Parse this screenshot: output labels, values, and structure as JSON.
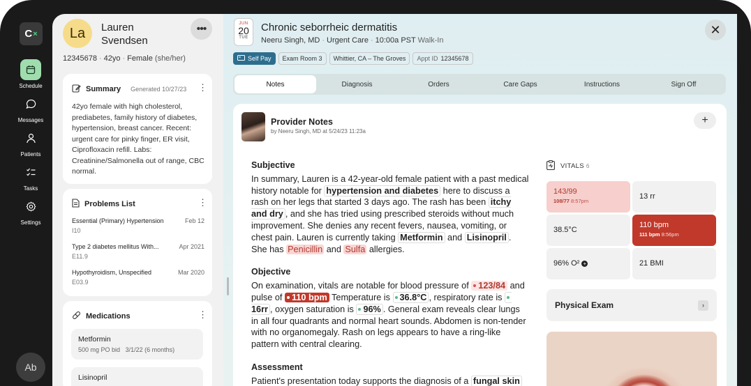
{
  "app": {
    "logo_text": "C",
    "logo_mark": "×"
  },
  "nav": [
    {
      "label": "Schedule",
      "icon": "calendar-icon",
      "active": true
    },
    {
      "label": "Messages",
      "icon": "message-icon",
      "active": false
    },
    {
      "label": "Patients",
      "icon": "person-icon",
      "active": false
    },
    {
      "label": "Tasks",
      "icon": "tasks-icon",
      "active": false
    },
    {
      "label": "Settings",
      "icon": "gear-icon",
      "active": false
    }
  ],
  "user": {
    "initials": "Ab"
  },
  "patient": {
    "initials": "La",
    "first_name": "Lauren",
    "last_name": "Svendsen",
    "mrn": "12345678",
    "age": "42yo",
    "sex": "Female",
    "pronouns": "(she/her)"
  },
  "summary": {
    "title": "Summary",
    "generated": "Generated 10/27/23",
    "text": "42yo female with high cholesterol, prediabetes, family history of diabetes, hypertension, breast cancer. Recent: urgent care for pinky finger, ER visit, Ciprofloxacin refill. Labs: Creatinine/Salmonella out of range, CBC normal."
  },
  "problems": {
    "title": "Problems List",
    "items": [
      {
        "name": "Essential (Primary) Hypertension",
        "code": "I10",
        "date": "Feb 12"
      },
      {
        "name": "Type 2 diabetes mellitus With...",
        "code": "E11.9",
        "date": "Apr 2021"
      },
      {
        "name": "Hypothyroidism, Unspecified",
        "code": "E03.9",
        "date": "Mar 2020"
      }
    ]
  },
  "medications": {
    "title": "Medications",
    "items": [
      {
        "name": "Metformin",
        "sig": "500 mg PO bid",
        "date": "3/1/22 (6 months)"
      },
      {
        "name": "Lisinopril",
        "sig": "",
        "date": ""
      }
    ]
  },
  "encounter": {
    "month": "JUN",
    "day": "20",
    "weekday": "TUE",
    "title": "Chronic seborrheic dermatitis",
    "provider": "Neeru Singh, MD",
    "type": "Urgent Care",
    "time": "10:00a PST",
    "visit": "Walk-In",
    "tags": {
      "pay": "Self Pay",
      "room": "Exam Room 3",
      "location": "Whittier, CA – The Groves",
      "appt_label": "Appt ID",
      "appt_id": "12345678"
    }
  },
  "tabs": [
    "Notes",
    "Diagnosis",
    "Orders",
    "Care Gaps",
    "Instructions",
    "Sign Off"
  ],
  "notes": {
    "title": "Provider Notes",
    "by": "by Neeru Singh, MD at 5/24/23 11:23a",
    "subjective": {
      "heading": "Subjective",
      "t1": "In summary, Lauren is a 42-year-old female patient with a past medical history notable for",
      "h1": "hypertension and diabetes",
      "t2": "here to discuss a rash on her legs that started 3 days ago. The rash has been",
      "h2": "itchy and dry",
      "t3": ", and she has tried using prescribed steroids without much improvement. She denies any recent fevers, nausea, vomiting, or chest pain. Lauren is currently taking",
      "h3": "Metformin",
      "t4": "and",
      "h4": "Lisinopril",
      "t5": ". She has",
      "a1": "Penicillin",
      "t6": "and",
      "a2": "Sulfa",
      "t7": "allergies."
    },
    "objective": {
      "heading": "Objective",
      "t1": "On examination, vitals are notable for blood pressure of",
      "bp": "123/84",
      "t2": "and pulse of",
      "pulse": "110 bpm",
      "t3": "Temperature is",
      "temp": "36.8°C",
      "t4": ", respiratory rate is",
      "rr": "16rr",
      "t5": ", oxygen saturation is",
      "o2": "96%",
      "t6": ". General exam reveals clear lungs in all four quadrants and normal heart sounds. Abdomen is non-tender with no organomegaly. Rash on legs appears to have a ring-like pattern with central clearing."
    },
    "assessment": {
      "heading": "Assessment",
      "t1": "Patient's presentation today supports the diagnosis of a",
      "h1": "fungal skin"
    }
  },
  "vitals": {
    "label": "VITALS",
    "count": "6",
    "items": [
      {
        "value": "143/99",
        "sub_value": "108/77",
        "sub_time": "8:57pm",
        "status": "bad"
      },
      {
        "value": "13 rr",
        "sub_value": "",
        "sub_time": "",
        "status": "normal"
      },
      {
        "value": "38.5°C",
        "sub_value": "",
        "sub_time": "",
        "status": "normal"
      },
      {
        "value": "110 bpm",
        "sub_value": "111 bpm",
        "sub_time": "8:56pm",
        "status": "danger"
      },
      {
        "value": "96% O²",
        "sub_value": "",
        "sub_time": "",
        "status": "normal"
      },
      {
        "value": "21 BMI",
        "sub_value": "",
        "sub_time": "",
        "status": "normal"
      }
    ]
  },
  "physical_exam": {
    "label": "Physical Exam"
  },
  "colors": {
    "accent": "#2d6e8e",
    "danger": "#c0392b",
    "warn_bg": "#f7cfcc",
    "active_nav": "#9fdcae"
  }
}
